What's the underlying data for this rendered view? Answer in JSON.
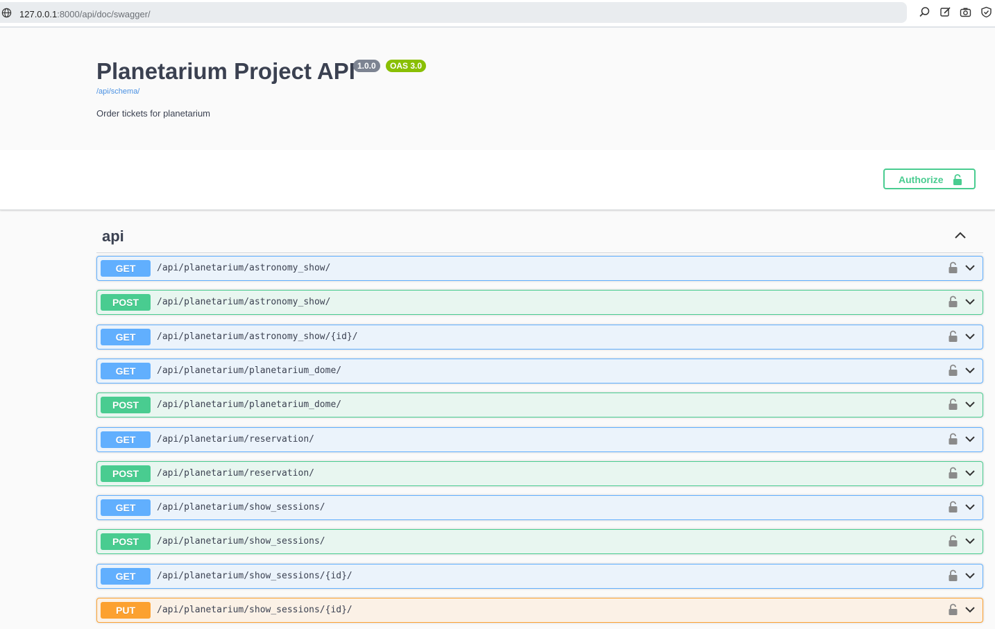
{
  "browser": {
    "url_host": "127.0.0.1",
    "url_rest": ":8000/api/doc/swagger/"
  },
  "info": {
    "title": "Planetarium Project API",
    "version_badge": "1.0.0",
    "oas_badge": "OAS 3.0",
    "schema_link": "/api/schema/",
    "description": "Order tickets for planetarium"
  },
  "scheme": {
    "authorize_label": "Authorize"
  },
  "tag": {
    "name": "api"
  },
  "colors": {
    "get": "#61affe",
    "post": "#49cc90",
    "put": "#fca130"
  },
  "operations": [
    {
      "method": "GET",
      "path": "/api/planetarium/astronomy_show/"
    },
    {
      "method": "POST",
      "path": "/api/planetarium/astronomy_show/"
    },
    {
      "method": "GET",
      "path": "/api/planetarium/astronomy_show/{id}/"
    },
    {
      "method": "GET",
      "path": "/api/planetarium/planetarium_dome/"
    },
    {
      "method": "POST",
      "path": "/api/planetarium/planetarium_dome/"
    },
    {
      "method": "GET",
      "path": "/api/planetarium/reservation/"
    },
    {
      "method": "POST",
      "path": "/api/planetarium/reservation/"
    },
    {
      "method": "GET",
      "path": "/api/planetarium/show_sessions/"
    },
    {
      "method": "POST",
      "path": "/api/planetarium/show_sessions/"
    },
    {
      "method": "GET",
      "path": "/api/planetarium/show_sessions/{id}/"
    },
    {
      "method": "PUT",
      "path": "/api/planetarium/show_sessions/{id}/"
    }
  ]
}
